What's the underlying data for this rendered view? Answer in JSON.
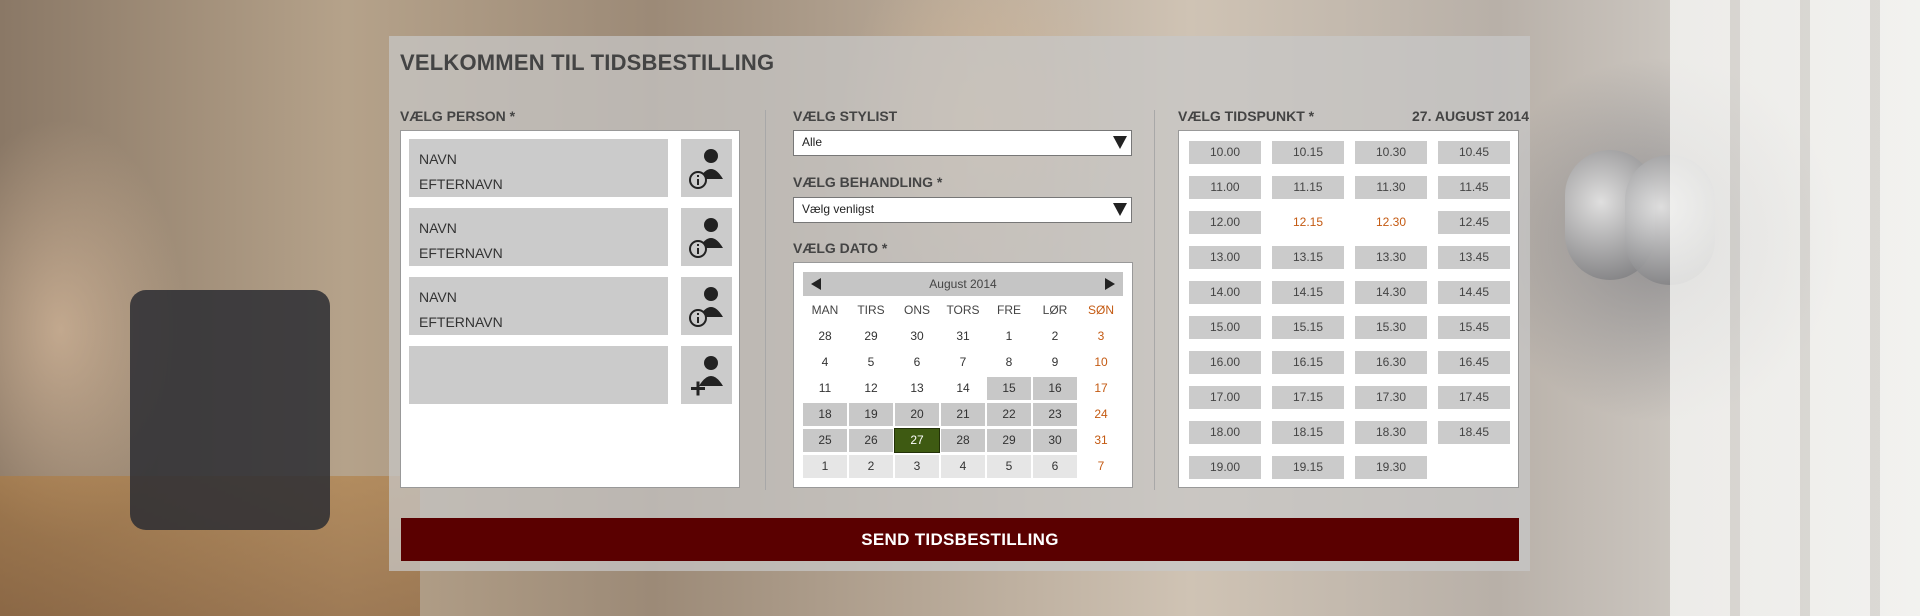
{
  "page": {
    "title": "VELKOMMEN TIL TIDSBESTILLING"
  },
  "person": {
    "label": "VÆLG PERSON *",
    "entries": [
      {
        "first": "NAVN",
        "last": "EFTERNAVN",
        "icon": "person-info-icon"
      },
      {
        "first": "NAVN",
        "last": "EFTERNAVN",
        "icon": "person-info-icon"
      },
      {
        "first": "NAVN",
        "last": "EFTERNAVN",
        "icon": "person-info-icon"
      },
      {
        "first": "",
        "last": "",
        "icon": "add-person-icon"
      }
    ]
  },
  "stylist": {
    "label": "VÆLG STYLIST",
    "value": "Alle"
  },
  "treatment": {
    "label": "VÆLG BEHANDLING *",
    "value": "Vælg venligst"
  },
  "date": {
    "label": "VÆLG DATO *",
    "month": "August 2014",
    "weekdays": [
      "MAN",
      "TIRS",
      "ONS",
      "TORS",
      "FRE",
      "LØR",
      "SØN"
    ],
    "weeks": [
      [
        "28",
        "29",
        "30",
        "31",
        "1",
        "2",
        "3"
      ],
      [
        "4",
        "5",
        "6",
        "7",
        "8",
        "9",
        "10"
      ],
      [
        "11",
        "12",
        "13",
        "14",
        "15",
        "16",
        "17"
      ],
      [
        "18",
        "19",
        "20",
        "21",
        "22",
        "23",
        "24"
      ],
      [
        "25",
        "26",
        "27",
        "28",
        "29",
        "30",
        "31"
      ],
      [
        "1",
        "2",
        "3",
        "4",
        "5",
        "6",
        "7"
      ]
    ],
    "selected": "27"
  },
  "time": {
    "label": "VÆLG TIDSPUNKT *",
    "date_label": "27. AUGUST 2014",
    "slots": [
      [
        "10.00",
        "10.15",
        "10.30",
        "10.45"
      ],
      [
        "11.00",
        "11.15",
        "11.30",
        "11.45"
      ],
      [
        "12.00",
        "12.15",
        "12.30",
        "12.45"
      ],
      [
        "13.00",
        "13.15",
        "13.30",
        "13.45"
      ],
      [
        "14.00",
        "14.15",
        "14.30",
        "14.45"
      ],
      [
        "15.00",
        "15.15",
        "15.30",
        "15.45"
      ],
      [
        "16.00",
        "16.15",
        "16.30",
        "16.45"
      ],
      [
        "17.00",
        "17.15",
        "17.30",
        "17.45"
      ],
      [
        "18.00",
        "18.15",
        "18.30",
        "18.45"
      ],
      [
        "19.00",
        "19.15",
        "19.30"
      ]
    ],
    "unavailable": [
      "12.15",
      "12.30"
    ]
  },
  "submit": {
    "label": "SEND TIDSBESTILLING"
  },
  "colors": {
    "accent": "#5a0000",
    "selected_date": "#3e5a12",
    "sunday": "#c45a12"
  }
}
